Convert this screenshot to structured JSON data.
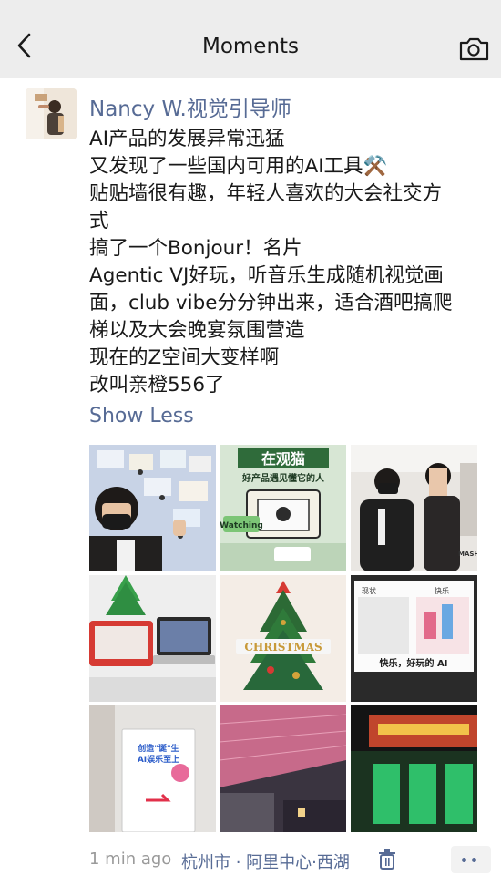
{
  "header": {
    "title": "Moments",
    "back_icon": "chevron-left-icon",
    "camera_icon": "camera-icon"
  },
  "post": {
    "author": "Nancy W.视觉引导师",
    "lines": [
      "AI产品的发展异常迅猛",
      "又发现了一些国内可用的AI工具⚒️",
      "贴贴墙很有趣，年轻人喜欢的大会社交方",
      "式",
      "搞了一个Bonjour！名片",
      "Agentic VJ好玩，听音乐生成随机视觉画",
      "面，club vibe分分钟出来，适合酒吧搞爬",
      "梯以及大会晚宴氛围营造",
      "现在的Z空间大变样啊",
      "改叫亲橙556了"
    ],
    "show_less": "Show Less",
    "photos": {
      "p2": {
        "line1": "在观猫",
        "line2": "好产品遇见懂它的人",
        "sign": "Watching"
      },
      "p3": {
        "sign": "MASHA DEMO"
      },
      "p5": {
        "banner": "CHRISTMAS"
      },
      "p6": {
        "left_label": "现状",
        "right_label": "快乐",
        "caption": "快乐，好玩的 AI"
      },
      "p7": {
        "poster_line1": "创造\"诞\"生",
        "poster_line2": "AI娱乐至上"
      }
    },
    "time": "1 min ago",
    "location": "杭州市 · 阿里中心·西湖",
    "delete_icon": "trash-icon",
    "more_icon": "more-dots-icon",
    "colors": {
      "link": "#576b95",
      "nav_bg": "#ededed",
      "meta": "#9a9a9a"
    }
  }
}
